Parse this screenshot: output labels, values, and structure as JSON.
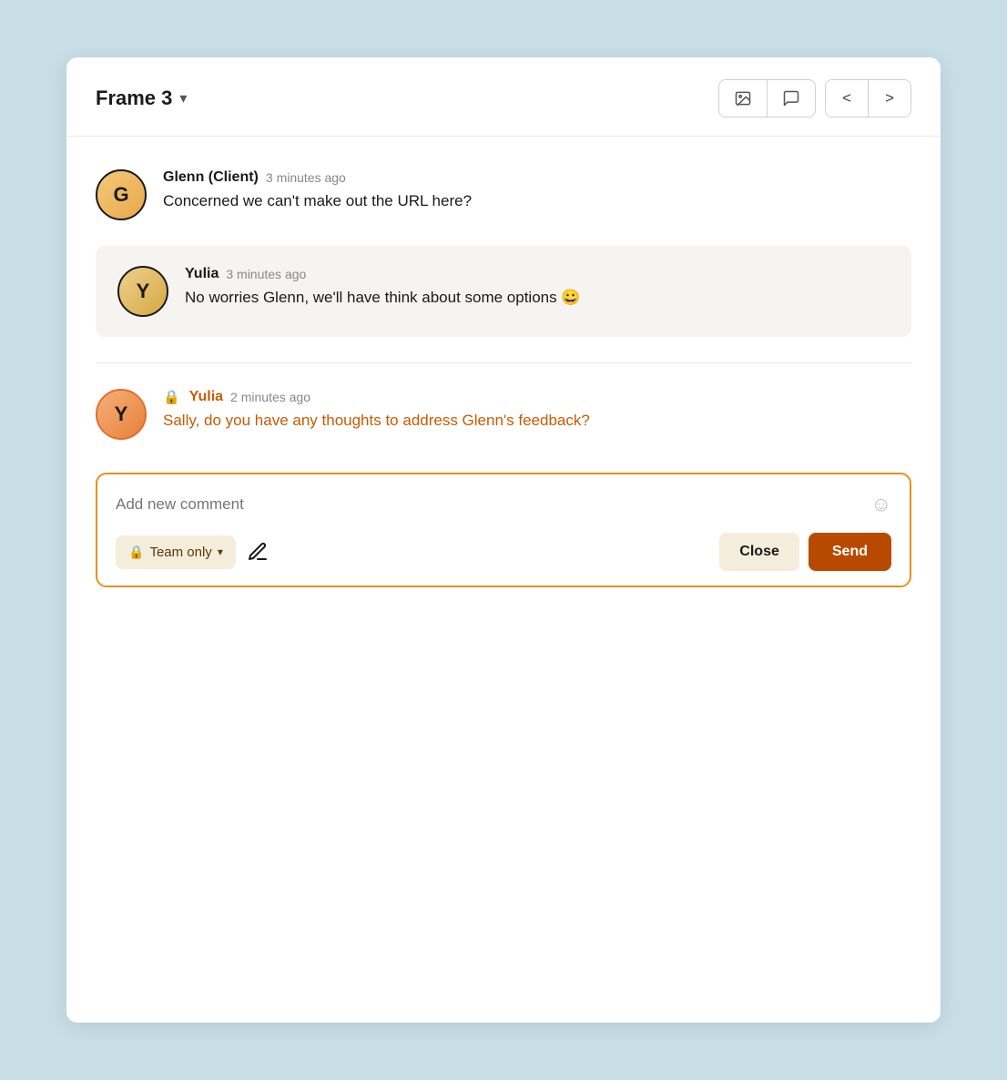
{
  "header": {
    "title": "Frame 3",
    "chevron": "▾",
    "nav_prev": "<",
    "nav_next": ">"
  },
  "comments": [
    {
      "id": "comment-1",
      "author": "Glenn (Client)",
      "time": "3 minutes ago",
      "text": "Concerned we can't make out the URL here?",
      "avatar_letter": "G",
      "avatar_style": "g",
      "private": false,
      "orange": false,
      "reply": {
        "author": "Yulia",
        "time": "3 minutes ago",
        "text": "No worries Glenn, we'll have think about some options 😀",
        "avatar_letter": "Y",
        "avatar_style": "y-dark",
        "orange": false
      }
    },
    {
      "id": "comment-2",
      "author": "Yulia",
      "time": "2 minutes ago",
      "text": "Sally, do you have any thoughts to address Glenn's feedback?",
      "avatar_letter": "Y",
      "avatar_style": "y-orange",
      "private": true,
      "orange": true,
      "reply": null
    }
  ],
  "input": {
    "placeholder": "Add new comment",
    "team_only_label": "Team only",
    "close_label": "Close",
    "send_label": "Send"
  }
}
